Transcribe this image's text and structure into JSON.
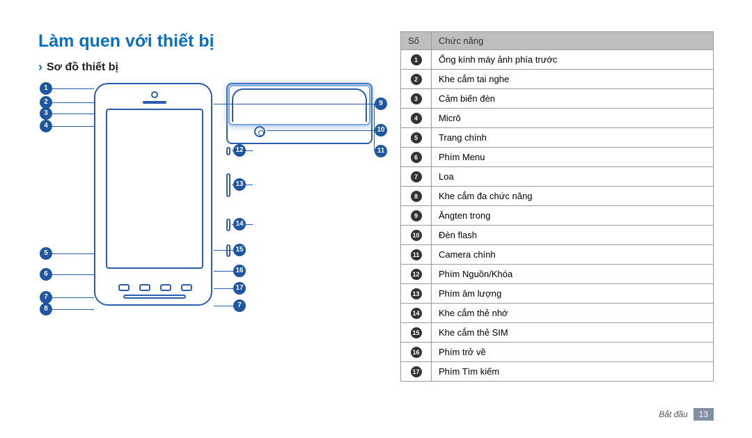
{
  "title": "Làm quen với thiết bị",
  "subtitle": "Sơ đồ thiết bị",
  "table": {
    "headers": {
      "num": "Số",
      "func": "Chức năng"
    },
    "rows": [
      {
        "n": "1",
        "func": "Ống kính máy ảnh phía trước"
      },
      {
        "n": "2",
        "func": "Khe cắm tai nghe"
      },
      {
        "n": "3",
        "func": "Cảm biến đèn"
      },
      {
        "n": "4",
        "func": "Micrô"
      },
      {
        "n": "5",
        "func": "Trang chính"
      },
      {
        "n": "6",
        "func": "Phím Menu"
      },
      {
        "n": "7",
        "func": "Loa"
      },
      {
        "n": "8",
        "func": "Khe cắm đa chức năng"
      },
      {
        "n": "9",
        "func": "Ăngten trong"
      },
      {
        "n": "10",
        "func": "Đèn flash"
      },
      {
        "n": "11",
        "func": "Camera chính"
      },
      {
        "n": "12",
        "func": "Phím Nguồn/Khóa"
      },
      {
        "n": "13",
        "func": "Phím âm lượng"
      },
      {
        "n": "14",
        "func": "Khe cắm thẻ nhớ"
      },
      {
        "n": "15",
        "func": "Khe cắm thẻ SIM"
      },
      {
        "n": "16",
        "func": "Phím trở về"
      },
      {
        "n": "17",
        "func": "Phím Tìm kiếm"
      }
    ]
  },
  "callouts_left": [
    "1",
    "2",
    "3",
    "4",
    "5",
    "6",
    "7",
    "8"
  ],
  "callouts_right": [
    "9",
    "10",
    "11",
    "12",
    "13",
    "14",
    "15",
    "16",
    "17",
    "7"
  ],
  "footer": {
    "section": "Bắt đầu",
    "page": "13"
  }
}
